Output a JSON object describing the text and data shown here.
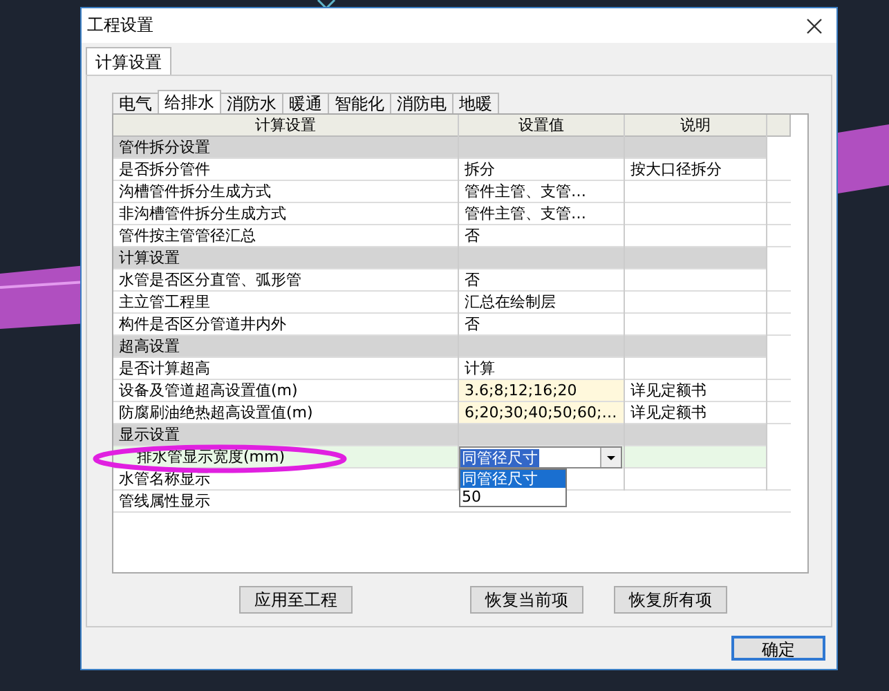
{
  "window": {
    "title": "工程设置"
  },
  "outer_tabs": [
    {
      "label": "计算设置",
      "selected": true
    }
  ],
  "inner_tabs": [
    {
      "label": "电气",
      "selected": false
    },
    {
      "label": "给排水",
      "selected": true
    },
    {
      "label": "消防水",
      "selected": false
    },
    {
      "label": "暖通",
      "selected": false
    },
    {
      "label": "智能化",
      "selected": false
    },
    {
      "label": "消防电",
      "selected": false
    },
    {
      "label": "地暖",
      "selected": false
    }
  ],
  "table": {
    "columns": [
      "计算设置",
      "设置值",
      "说明"
    ],
    "rows": [
      {
        "kind": "group",
        "name": "管件拆分设置"
      },
      {
        "kind": "setting",
        "name": "是否拆分管件",
        "value": "拆分",
        "note": "按大口径拆分"
      },
      {
        "kind": "setting",
        "name": "沟槽管件拆分生成方式",
        "value": "管件主管、支管…"
      },
      {
        "kind": "setting",
        "name": "非沟槽管件拆分生成方式",
        "value": "管件主管、支管…"
      },
      {
        "kind": "setting",
        "name": "管件按主管管径汇总",
        "value": "否"
      },
      {
        "kind": "group",
        "name": "计算设置"
      },
      {
        "kind": "setting",
        "name": "水管是否区分直管、弧形管",
        "value": "否"
      },
      {
        "kind": "setting",
        "name": "主立管工程里",
        "value": "汇总在绘制层"
      },
      {
        "kind": "setting",
        "name": "构件是否区分管道井内外",
        "value": "否"
      },
      {
        "kind": "group",
        "name": "超高设置"
      },
      {
        "kind": "setting",
        "name": "是否计算超高",
        "value": "计算"
      },
      {
        "kind": "setting",
        "name": "设备及管道超高设置值(m)",
        "value": "3.6;8;12;16;20",
        "note": "详见定额书",
        "editable": true
      },
      {
        "kind": "setting",
        "name": "防腐刷油绝热超高设置值(m)",
        "value": "6;20;30;40;50;60;…",
        "note": "详见定额书",
        "editable": true
      },
      {
        "kind": "group",
        "name": "显示设置"
      },
      {
        "kind": "combo",
        "name": "排水管显示宽度(mm)",
        "value": "同管径尺寸",
        "selected": true,
        "options": [
          {
            "label": "同管径尺寸",
            "selected": true
          },
          {
            "label": "50",
            "selected": false
          }
        ]
      },
      {
        "kind": "setting",
        "name": "水管名称显示"
      },
      {
        "kind": "setting",
        "name": "管线属性显示"
      }
    ]
  },
  "buttons": [
    "应用至工程",
    "恢复当前项",
    "恢复所有项"
  ],
  "ok_button": "确定"
}
